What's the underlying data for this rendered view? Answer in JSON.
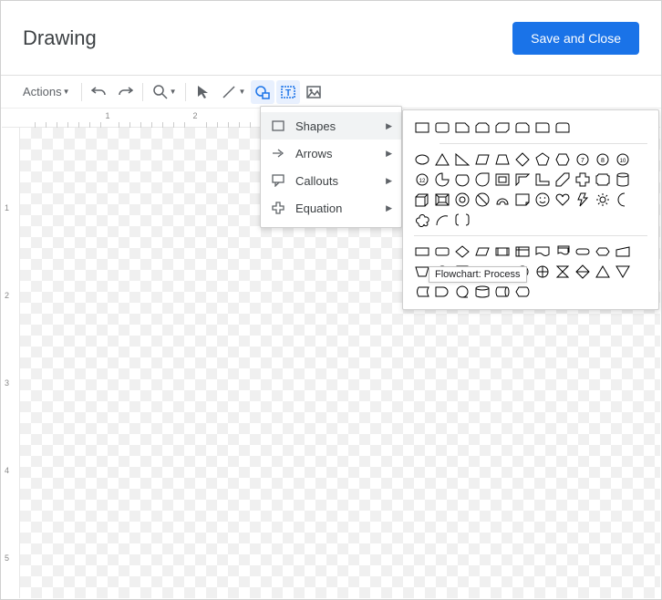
{
  "header": {
    "title": "Drawing",
    "save_label": "Save and Close"
  },
  "toolbar": {
    "actions_label": "Actions"
  },
  "menu": {
    "shapes": "Shapes",
    "arrows": "Arrows",
    "callouts": "Callouts",
    "equation": "Equation"
  },
  "tooltip": {
    "text": "Flowchart: Process"
  },
  "ruler": {
    "h_marks": [
      "1",
      "2"
    ],
    "v_marks": [
      "1",
      "2",
      "3",
      "4",
      "5"
    ]
  }
}
